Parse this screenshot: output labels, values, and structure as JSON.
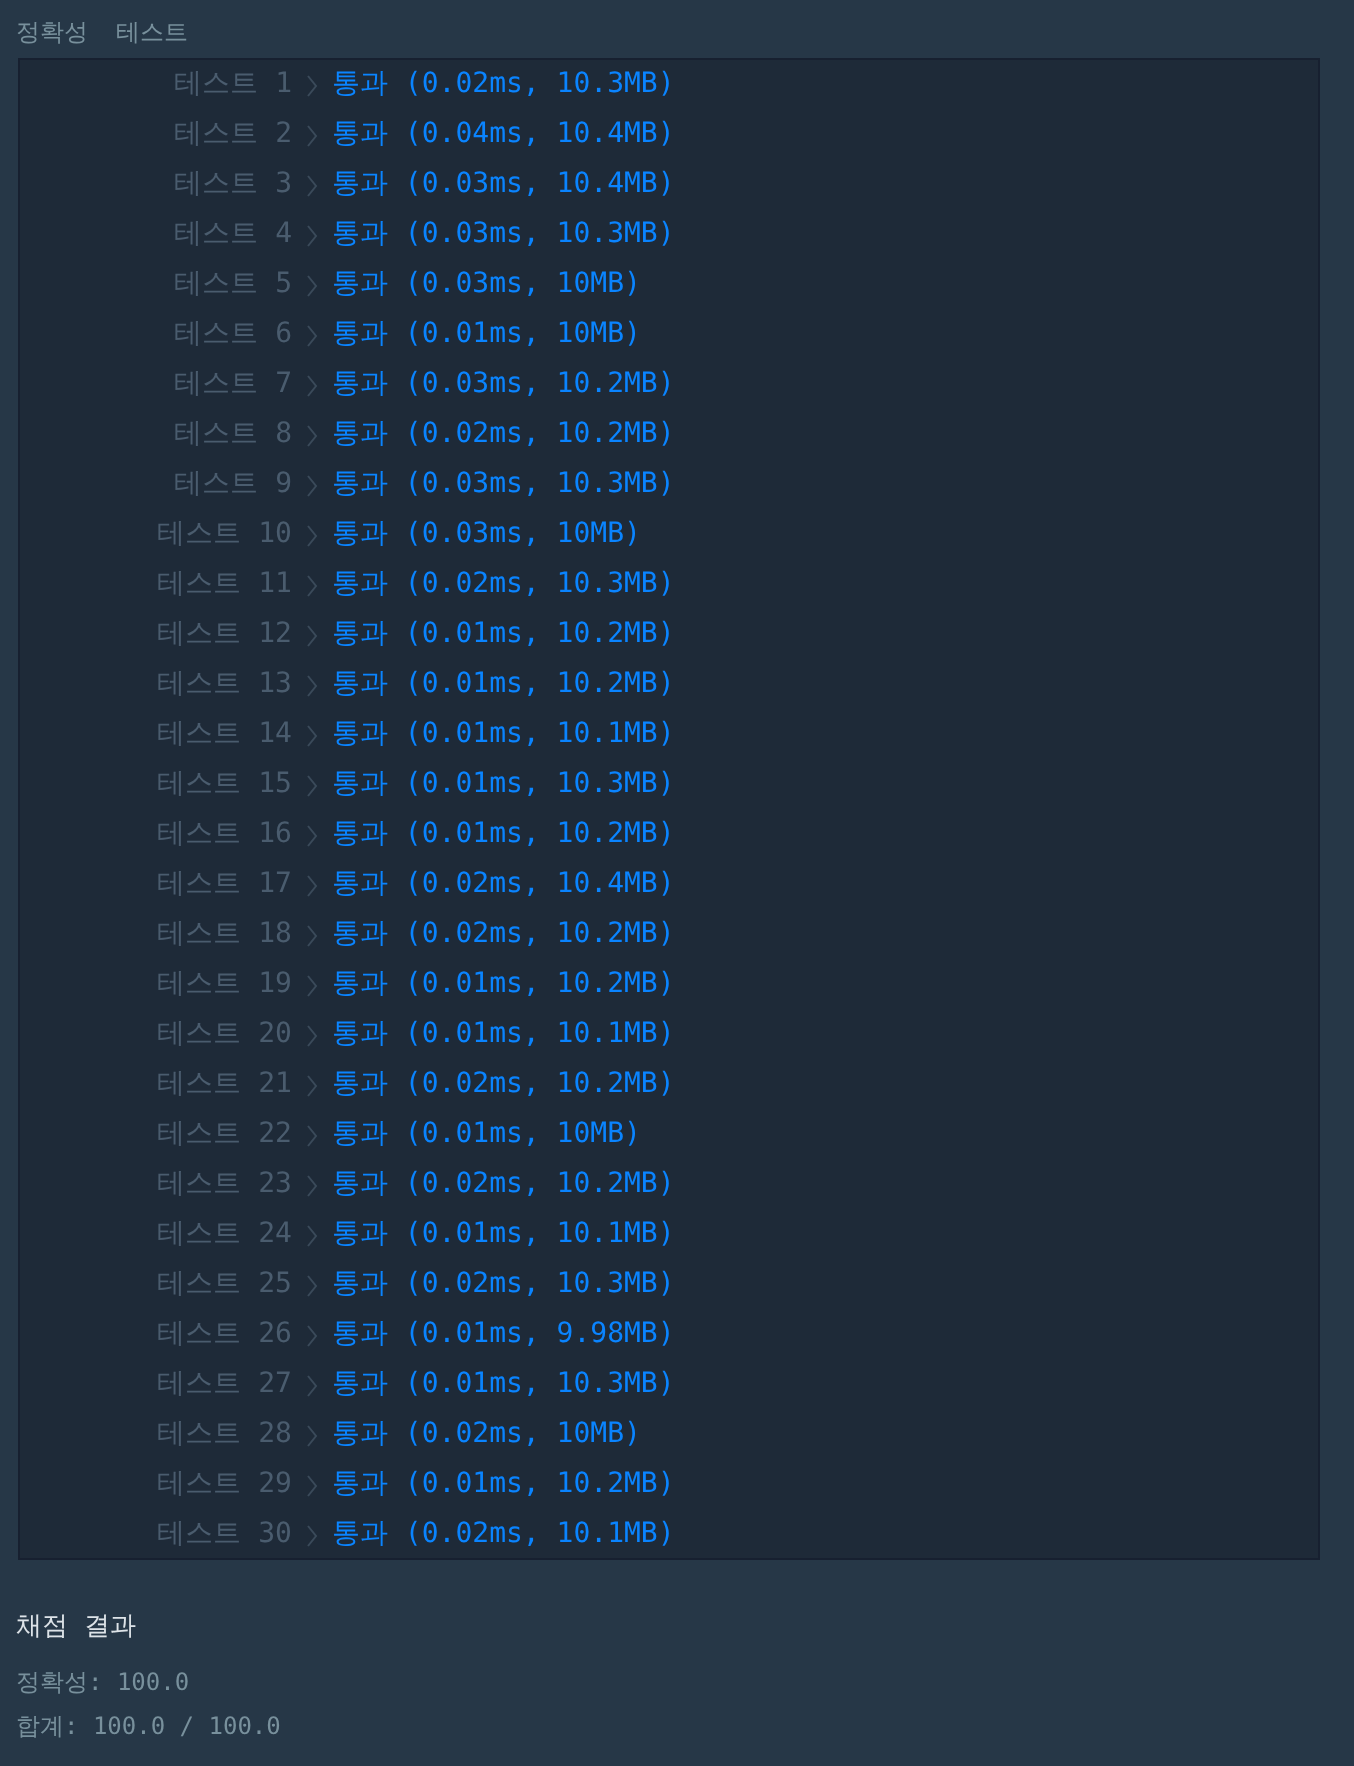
{
  "header": {
    "title": "정확성",
    "subtitle": "테스트"
  },
  "tests": [
    {
      "label": "테스트 1",
      "kind": "pass",
      "result": "통과 (0.02ms, 10.3MB)"
    },
    {
      "label": "테스트 2",
      "kind": "pass",
      "result": "통과 (0.04ms, 10.4MB)"
    },
    {
      "label": "테스트 3",
      "kind": "pass",
      "result": "통과 (0.03ms, 10.4MB)"
    },
    {
      "label": "테스트 4",
      "kind": "pass",
      "result": "통과 (0.03ms, 10.3MB)"
    },
    {
      "label": "테스트 5",
      "kind": "pass",
      "result": "통과 (0.03ms, 10MB)"
    },
    {
      "label": "테스트 6",
      "kind": "pass",
      "result": "통과 (0.01ms, 10MB)"
    },
    {
      "label": "테스트 7",
      "kind": "pass",
      "result": "통과 (0.03ms, 10.2MB)"
    },
    {
      "label": "테스트 8",
      "kind": "pass",
      "result": "통과 (0.02ms, 10.2MB)"
    },
    {
      "label": "테스트 9",
      "kind": "pass",
      "result": "통과 (0.03ms, 10.3MB)"
    },
    {
      "label": "테스트 10",
      "kind": "pass",
      "result": "통과 (0.03ms, 10MB)"
    },
    {
      "label": "테스트 11",
      "kind": "pass",
      "result": "통과 (0.02ms, 10.3MB)"
    },
    {
      "label": "테스트 12",
      "kind": "pass",
      "result": "통과 (0.01ms, 10.2MB)"
    },
    {
      "label": "테스트 13",
      "kind": "pass",
      "result": "통과 (0.01ms, 10.2MB)"
    },
    {
      "label": "테스트 14",
      "kind": "pass",
      "result": "통과 (0.01ms, 10.1MB)"
    },
    {
      "label": "테스트 15",
      "kind": "pass",
      "result": "통과 (0.01ms, 10.3MB)"
    },
    {
      "label": "테스트 16",
      "kind": "pass",
      "result": "통과 (0.01ms, 10.2MB)"
    },
    {
      "label": "테스트 17",
      "kind": "pass",
      "result": "통과 (0.02ms, 10.4MB)"
    },
    {
      "label": "테스트 18",
      "kind": "pass",
      "result": "통과 (0.02ms, 10.2MB)"
    },
    {
      "label": "테스트 19",
      "kind": "pass",
      "result": "통과 (0.01ms, 10.2MB)"
    },
    {
      "label": "테스트 20",
      "kind": "pass",
      "result": "통과 (0.01ms, 10.1MB)"
    },
    {
      "label": "테스트 21",
      "kind": "pass",
      "result": "통과 (0.02ms, 10.2MB)"
    },
    {
      "label": "테스트 22",
      "kind": "pass",
      "result": "통과 (0.01ms, 10MB)"
    },
    {
      "label": "테스트 23",
      "kind": "pass",
      "result": "통과 (0.02ms, 10.2MB)"
    },
    {
      "label": "테스트 24",
      "kind": "pass",
      "result": "통과 (0.01ms, 10.1MB)"
    },
    {
      "label": "테스트 25",
      "kind": "pass",
      "result": "통과 (0.02ms, 10.3MB)"
    },
    {
      "label": "테스트 26",
      "kind": "pass",
      "result": "통과 (0.01ms, 9.98MB)"
    },
    {
      "label": "테스트 27",
      "kind": "pass",
      "result": "통과 (0.01ms, 10.3MB)"
    },
    {
      "label": "테스트 28",
      "kind": "pass",
      "result": "통과 (0.02ms, 10MB)"
    },
    {
      "label": "테스트 29",
      "kind": "pass",
      "result": "통과 (0.01ms, 10.2MB)"
    },
    {
      "label": "테스트 30",
      "kind": "pass",
      "result": "통과 (0.02ms, 10.1MB)"
    }
  ],
  "summary": {
    "title": "채점 결과",
    "lines": [
      "정확성: 100.0",
      "합계: 100.0 / 100.0"
    ]
  }
}
